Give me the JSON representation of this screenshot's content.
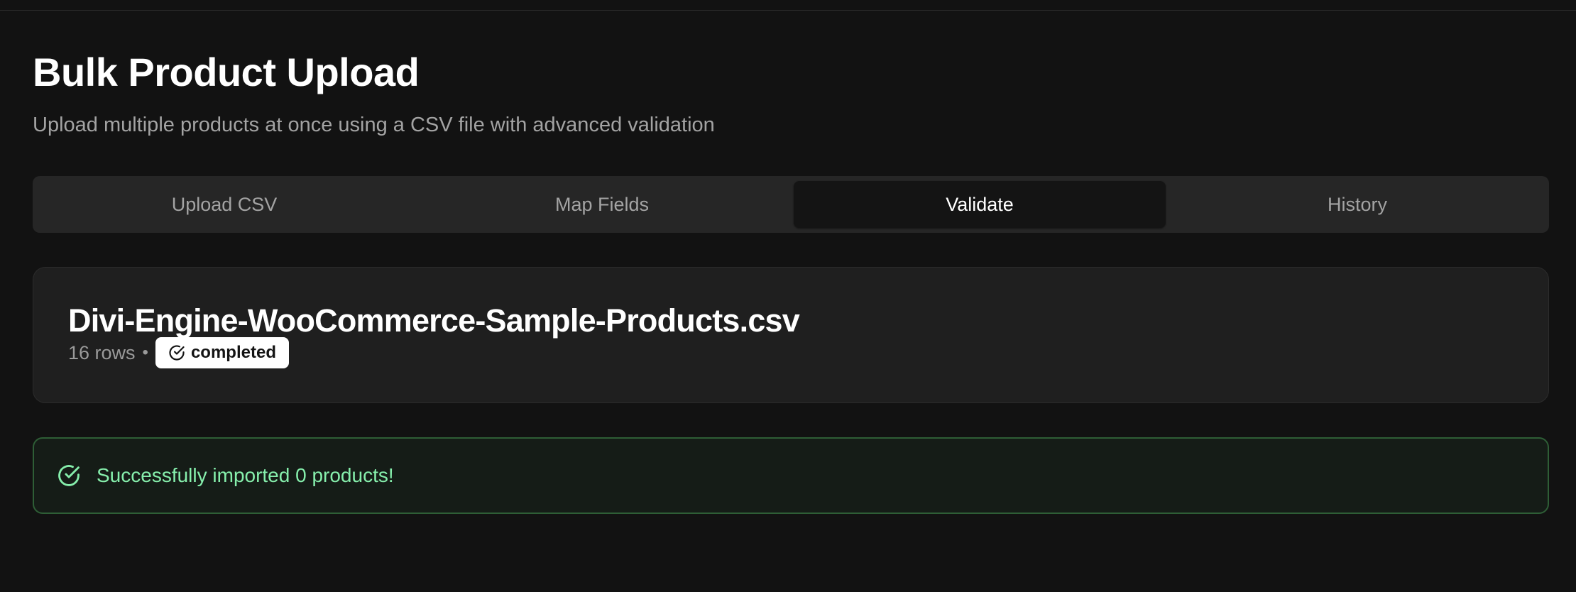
{
  "header": {
    "title": "Bulk Product Upload",
    "subtitle": "Upload multiple products at once using a CSV file with advanced validation"
  },
  "tabs": [
    {
      "label": "Upload CSV",
      "active": false
    },
    {
      "label": "Map Fields",
      "active": false
    },
    {
      "label": "Validate",
      "active": true
    },
    {
      "label": "History",
      "active": false
    }
  ],
  "file": {
    "name": "Divi-Engine-WooCommerce-Sample-Products.csv",
    "rows": "16 rows",
    "separator": "•",
    "status_icon": "check-circle-icon",
    "status": "completed"
  },
  "alert": {
    "icon": "check-circle-icon",
    "message": "Successfully imported 0 products!",
    "color": "#86efac"
  },
  "colors": {
    "background": "#121212",
    "card": "#1f1f1f",
    "success_border": "#2e5e36"
  }
}
